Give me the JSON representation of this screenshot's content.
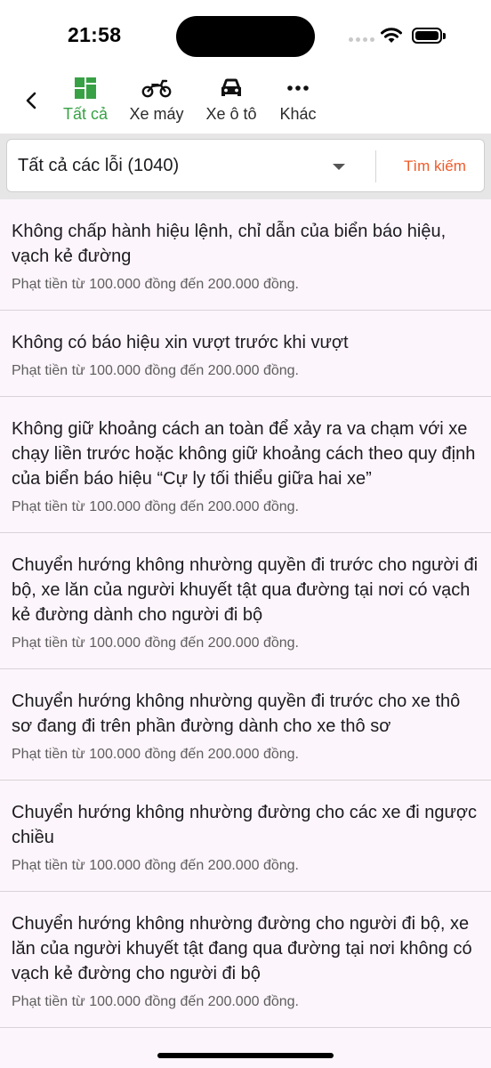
{
  "status": {
    "time": "21:58"
  },
  "tabs": [
    {
      "label": "Tất cả",
      "icon": "grid-icon",
      "active": true
    },
    {
      "label": "Xe máy",
      "icon": "motorbike-icon"
    },
    {
      "label": "Xe ô tô",
      "icon": "car-icon"
    },
    {
      "label": "Khác",
      "icon": "more-icon"
    }
  ],
  "filter": {
    "selected": "Tất cả các lỗi (1040)",
    "search_label": "Tìm kiếm"
  },
  "colors": {
    "accent": "#38a145",
    "search": "#f05a28",
    "background": "#fcf5fb"
  },
  "violations": [
    {
      "title": "Không chấp hành hiệu lệnh, chỉ dẫn của biển báo hiệu, vạch kẻ đường",
      "fine": "Phạt tiền từ 100.000 đồng đến 200.000 đồng."
    },
    {
      "title": "Không có báo hiệu xin vượt trước khi vượt",
      "fine": "Phạt tiền từ 100.000 đồng đến 200.000 đồng."
    },
    {
      "title": "Không giữ khoảng cách an toàn để xảy ra va chạm với xe chạy liền trước hoặc không giữ khoảng cách theo quy định của biển báo hiệu “Cự ly tối thiểu giữa hai xe”",
      "fine": "Phạt tiền từ 100.000 đồng đến 200.000 đồng."
    },
    {
      "title": "Chuyển hướng không nhường quyền đi trước cho người đi bộ, xe lăn của người khuyết tật qua đường tại nơi có vạch kẻ đường dành cho người đi bộ",
      "fine": "Phạt tiền từ 100.000 đồng đến 200.000 đồng."
    },
    {
      "title": "Chuyển hướng không nhường quyền đi trước cho xe thô sơ đang đi trên phần đường dành cho xe thô sơ",
      "fine": "Phạt tiền từ 100.000 đồng đến 200.000 đồng."
    },
    {
      "title": "Chuyển hướng không nhường đường cho các xe đi ngược chiều",
      "fine": "Phạt tiền từ 100.000 đồng đến 200.000 đồng."
    },
    {
      "title": "Chuyển hướng không nhường đường cho người đi bộ, xe lăn của người khuyết tật đang qua đường tại nơi không có vạch kẻ đường cho người đi bộ",
      "fine": "Phạt tiền từ 100.000 đồng đến 200.000 đồng."
    }
  ]
}
